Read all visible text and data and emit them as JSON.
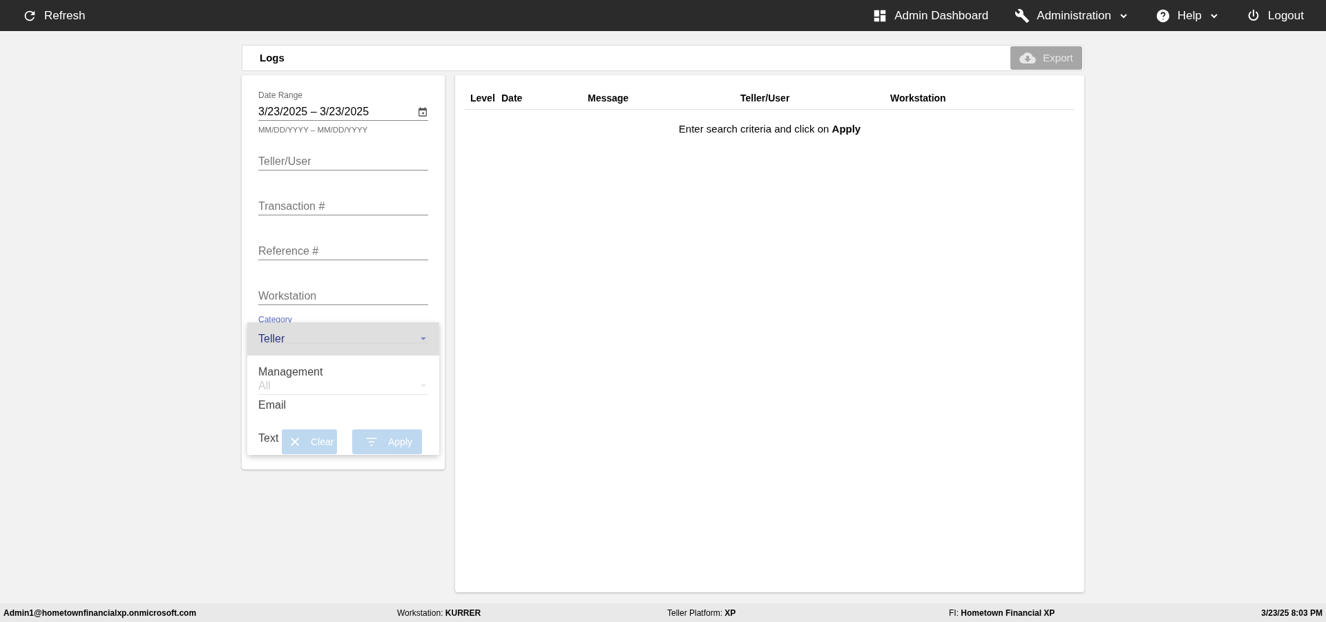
{
  "top_bar": {
    "left": [
      {
        "label": "Refresh",
        "kind": "refresh"
      }
    ],
    "right": [
      {
        "label": "Admin Dashboard",
        "kind": "dashboard",
        "has_menu": false
      },
      {
        "label": "Administration",
        "kind": "wrench",
        "has_menu": true
      },
      {
        "label": "Help",
        "kind": "help",
        "has_menu": true
      },
      {
        "label": "Logout",
        "kind": "power",
        "has_menu": false
      }
    ]
  },
  "header": {
    "title": "Logs",
    "export": {
      "label": "Export",
      "disabled": true
    }
  },
  "filters": {
    "date_range": {
      "label": "Date Range",
      "value": "3/23/2025 – 3/23/2025",
      "hint": "MM/DD/YYYY – MM/DD/YYYY"
    },
    "fields": [
      {
        "placeholder": "Teller/User"
      },
      {
        "placeholder": "Transaction #"
      },
      {
        "placeholder": "Reference #"
      },
      {
        "placeholder": "Workstation"
      }
    ],
    "category": {
      "label": "Category",
      "expanded": true,
      "options": [
        {
          "label": "Teller",
          "selected": true
        },
        {
          "label": "Management",
          "selected": false
        },
        {
          "label": "Email",
          "selected": false
        },
        {
          "label": "Text",
          "selected": false
        }
      ]
    },
    "level": {
      "value": "All"
    },
    "buttons": [
      {
        "label": "Clear",
        "kind": "clear",
        "disabled": true
      },
      {
        "label": "Apply",
        "kind": "filter",
        "disabled": true
      }
    ]
  },
  "table": {
    "columns": [
      "Level",
      "Date",
      "Message",
      "Teller/User",
      "Workstation"
    ],
    "empty_message": "Enter search criteria and click on **Apply**"
  },
  "status_bar": [
    {
      "value": "Admin1@hometownfinancialxp.onmicrosoft.com"
    },
    {
      "label": "Workstation:",
      "value": "KURRER"
    },
    {
      "label": "Teller Platform:",
      "value": "XP"
    },
    {
      "label": "FI:",
      "value": "Hometown Financial XP"
    },
    {
      "value": "3/23/25 8:03 PM"
    }
  ]
}
